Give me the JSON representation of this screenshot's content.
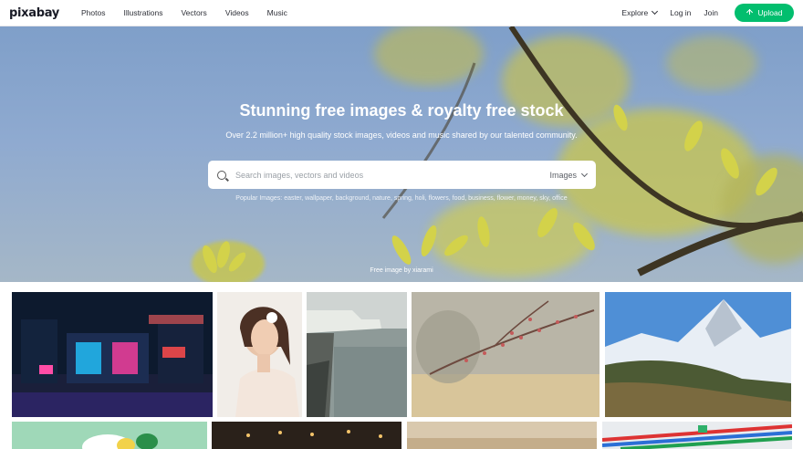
{
  "header": {
    "logo": "pixabay",
    "nav": [
      "Photos",
      "Illustrations",
      "Vectors",
      "Videos",
      "Music"
    ],
    "explore": "Explore",
    "login": "Log in",
    "join": "Join",
    "upload": "Upload"
  },
  "hero": {
    "title": "Stunning free images & royalty free stock",
    "subtitle": "Over 2.2 million+ high quality stock images, videos and music shared by our talented community.",
    "search_placeholder": "Search images, vectors and videos",
    "search_type": "Images",
    "popular": "Popular Images: easter, wallpaper, background, nature, spring, holi, flowers, food, business, flower, money, sky, office",
    "credit": "Free image by xiarami"
  },
  "colors": {
    "brand_green": "#02be6e",
    "text": "#191b26"
  },
  "grid_icons": [
    "neon-street-photo",
    "woman-portrait-photo",
    "coastal-cliff-photo",
    "blossom-branch-photo",
    "mountain-peak-photo",
    "lemon-illustration-photo",
    "restaurant-interior-photo",
    "wood-table-photo",
    "laptop-desk-photo",
    "colored-pencils-photo"
  ]
}
